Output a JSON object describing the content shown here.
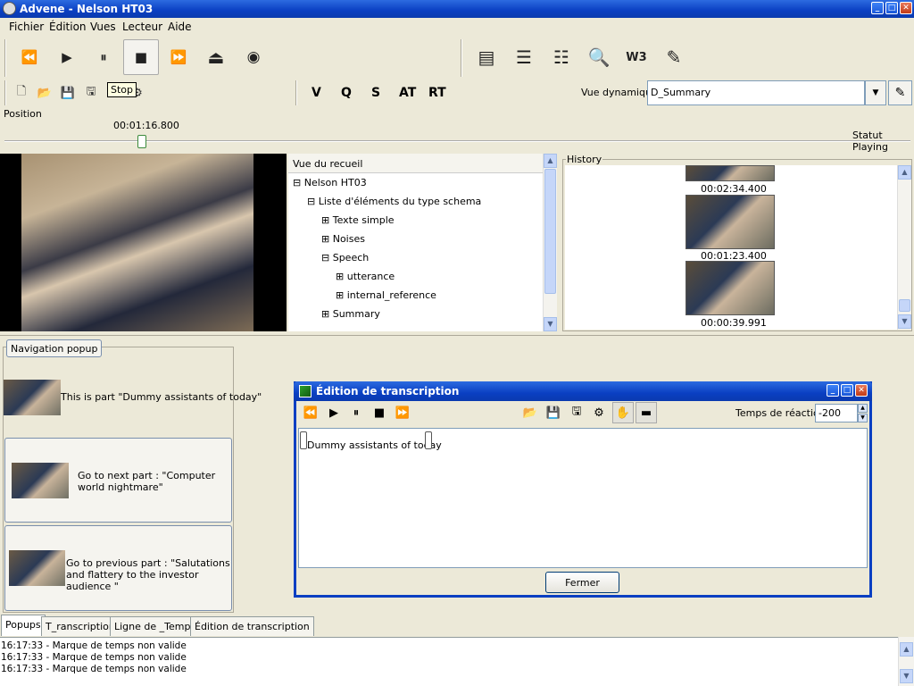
{
  "window": {
    "title": "Advene - Nelson HT03",
    "minimize": "_",
    "maximize": "□",
    "close": "✕"
  },
  "menu": [
    "Fichier",
    "Édition",
    "Vues",
    "Lecteur",
    "Aide"
  ],
  "player_toolbar": [
    {
      "name": "rewind-icon",
      "glyph": "⏪"
    },
    {
      "name": "play-icon",
      "glyph": "▶"
    },
    {
      "name": "pause-icon",
      "glyph": "⏸"
    },
    {
      "name": "stop-icon",
      "glyph": "■"
    },
    {
      "name": "forward-icon",
      "glyph": "⏩"
    },
    {
      "name": "eject-icon",
      "glyph": "⏏"
    },
    {
      "name": "record-icon",
      "glyph": "◉"
    }
  ],
  "views_toolbar": [
    {
      "name": "timeline-view-icon",
      "glyph": "▤"
    },
    {
      "name": "tree-view-icon",
      "glyph": "☰"
    },
    {
      "name": "transcription-view-icon",
      "glyph": "☷"
    },
    {
      "name": "search-icon",
      "glyph": "🔍"
    },
    {
      "name": "w3-web-icon",
      "glyph": "W3"
    },
    {
      "name": "edit-notes-icon",
      "glyph": "✎"
    }
  ],
  "file_toolbar": [
    {
      "name": "new-file-icon",
      "glyph": "🗋"
    },
    {
      "name": "open-folder-icon",
      "glyph": "📂"
    },
    {
      "name": "save-icon",
      "glyph": "💾"
    },
    {
      "name": "save-as-icon",
      "glyph": "🖫"
    },
    {
      "name": "import-icon",
      "glyph": "⚙"
    }
  ],
  "tooltip": "Stop",
  "quick_buttons": [
    "V",
    "Q",
    "S",
    "AT",
    "RT"
  ],
  "dynamic_view": {
    "label": "Vue dynamique",
    "value": "D_Summary",
    "arrow": "▼",
    "edit_glyph": "✎"
  },
  "position": {
    "label": "Position",
    "timestamp": "00:01:16.800",
    "status": "Statut Playing",
    "progress_fraction": 0.152
  },
  "tree": {
    "header": "Vue du recueil",
    "rows": [
      {
        "label": "Nelson HT03",
        "sign": "⊟"
      },
      {
        "label": "Liste d'éléments du type schema",
        "sign": "⊟"
      },
      {
        "label": "Texte simple",
        "sign": "⊞"
      },
      {
        "label": "Noises",
        "sign": "⊞"
      },
      {
        "label": "Speech",
        "sign": "⊟"
      },
      {
        "label": "utterance",
        "sign": "⊞"
      },
      {
        "label": "internal_reference",
        "sign": "⊞"
      },
      {
        "label": "Summary",
        "sign": "⊞"
      }
    ]
  },
  "history": {
    "label": "History",
    "items": [
      "00:02:34.400",
      "00:01:23.400",
      "00:00:39.991"
    ]
  },
  "navigation_popup": {
    "label": "Navigation popup",
    "current": "This is part \"Dummy assistants of today\"",
    "next": "Go to next part : \"Computer world nightmare\"",
    "previous": "Go to previous part : \"Salutations and flattery to the investor audience \""
  },
  "transcription_dialog": {
    "title": "Édition de transcription",
    "controls": [
      "⏪",
      "▶",
      "⏸",
      "■",
      "⏩"
    ],
    "file_controls": [
      "📂",
      "💾",
      "🖫",
      "⚙",
      "✋",
      "▬"
    ],
    "reaction_label": "Temps de réaction",
    "reaction_value": "-200",
    "text": "Dummy assistants of today",
    "close_button": "Fermer",
    "minimize": "_",
    "maximize": "□",
    "close": "✕"
  },
  "tabs": [
    "Popups",
    "T_ranscription",
    "Ligne de _Temps",
    "Édition de transcription"
  ],
  "log": [
    "16:17:33 - Marque de temps non valide",
    "16:17:33 - Marque de temps non valide",
    "16:17:33 - Marque de temps non valide"
  ],
  "scroll_arrows": {
    "up": "▲",
    "down": "▼"
  }
}
